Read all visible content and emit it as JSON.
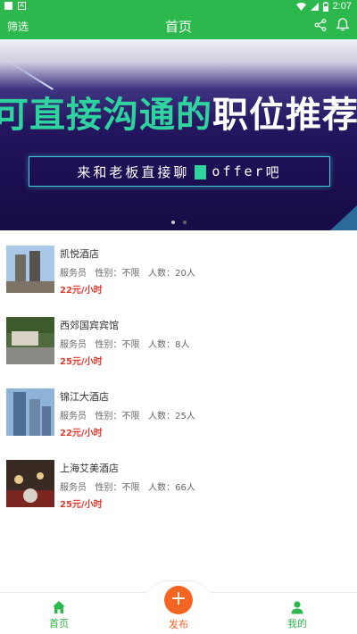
{
  "status_bar": {
    "time": "2:07"
  },
  "header": {
    "filter_label": "筛选",
    "title": "首页"
  },
  "banner": {
    "headline_green_1": "可直接沟通的",
    "headline_white": "职位推",
    "headline_green_2": "荐",
    "subline_1": "来和老板直接聊",
    "subline_offer": "offer",
    "subline_2": "吧"
  },
  "jobs": [
    {
      "name": "凯悦酒店",
      "role": "服务员",
      "gender": "性别：不限",
      "count": "人数：20人",
      "price": "22元/小时"
    },
    {
      "name": "西郊国宾宾馆",
      "role": "服务员",
      "gender": "性别：不限",
      "count": "人数：8人",
      "price": "25元/小时"
    },
    {
      "name": "锦江大酒店",
      "role": "服务员",
      "gender": "性别：不限",
      "count": "人数：25人",
      "price": "22元/小时"
    },
    {
      "name": "上海艾美酒店",
      "role": "服务员",
      "gender": "性别：不限",
      "count": "人数：66人",
      "price": "25元/小时"
    }
  ],
  "nav": {
    "home": "首页",
    "publish": "发布",
    "mine": "我的"
  },
  "colors": {
    "primary": "#2db84d",
    "accent": "#f26522",
    "price": "#e33a2c"
  },
  "icons": [
    "share-icon",
    "bell-icon",
    "home-icon",
    "plus-icon",
    "user-icon"
  ]
}
